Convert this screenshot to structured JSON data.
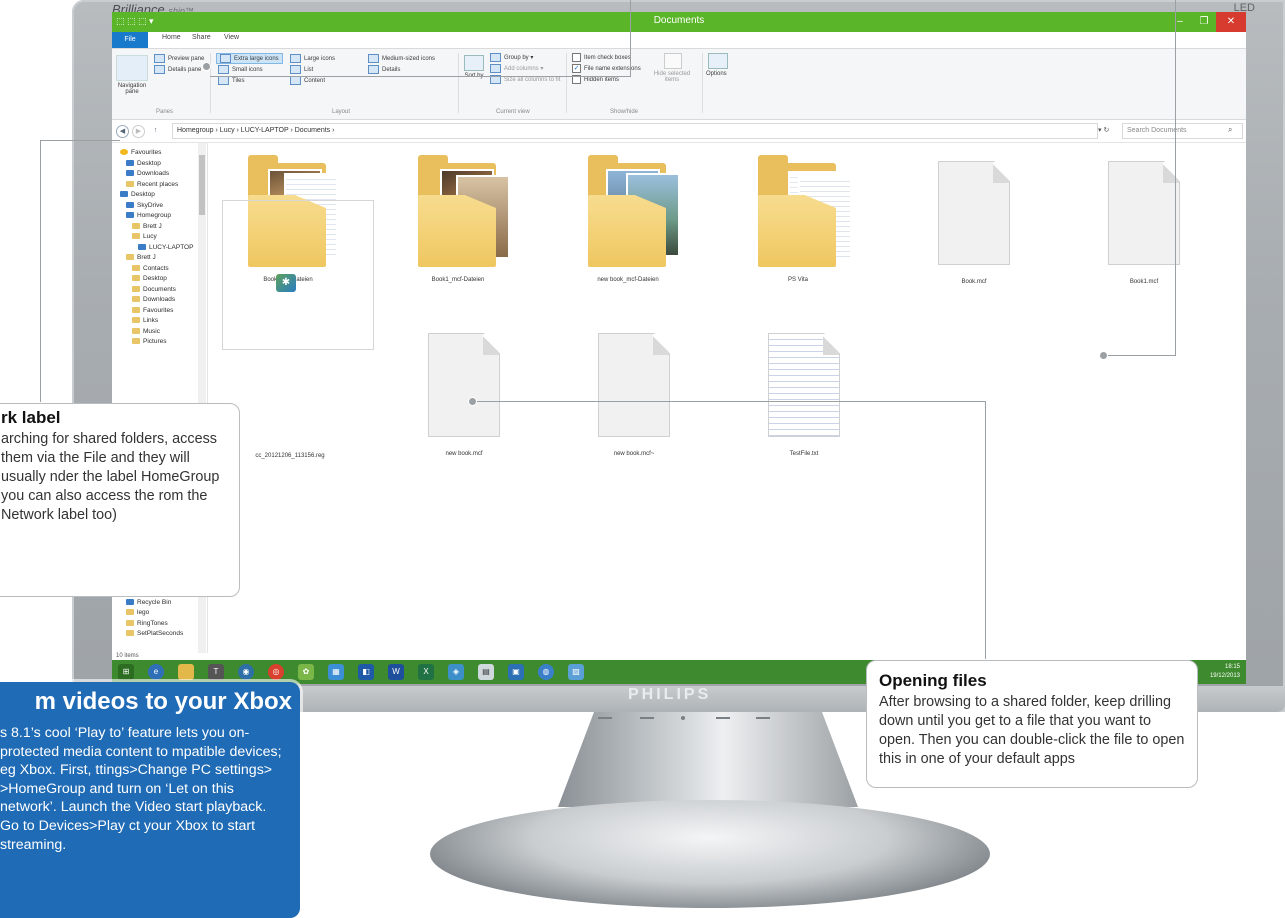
{
  "monitor": {
    "brand": "Brilliance",
    "brand_suffix": "ship™",
    "badge": "LED",
    "logo": "PHILIPS"
  },
  "window": {
    "title": "Documents",
    "qat": "⬚ ⬚ ⬚ ▾",
    "controls": {
      "minimize": "–",
      "maximize": "❐",
      "close": "✕"
    }
  },
  "ribbon": {
    "tabs": [
      "File",
      "Home",
      "Share",
      "View"
    ],
    "panes": {
      "nav_pane": "Navigation pane",
      "preview_pane": "Preview pane",
      "details_pane": "Details pane",
      "group": "Panes"
    },
    "layout": {
      "extra_large": "Extra large icons",
      "large": "Large icons",
      "medium": "Medium-sized icons",
      "small": "Small icons",
      "list": "List",
      "details": "Details",
      "tiles": "Tiles",
      "content": "Content",
      "group": "Layout"
    },
    "current_view": {
      "sort_by": "Sort by",
      "group_by": "Group by",
      "add_columns": "Add columns",
      "size_all": "Size all columns to fit",
      "group": "Current view"
    },
    "show_hide": {
      "item_check": "Item check boxes",
      "file_ext": "File name extensions",
      "hidden": "Hidden items",
      "hide_selected": "Hide selected items",
      "group": "Show/hide"
    },
    "options": "Options"
  },
  "address": {
    "path": "Homegroup  ›  Lucy  ›  LUCY-LAPTOP  ›  Documents  ›",
    "search_placeholder": "Search Documents"
  },
  "nav": [
    {
      "label": "Favourites",
      "icon": "star"
    },
    {
      "label": "Desktop",
      "icon": "blue"
    },
    {
      "label": "Downloads",
      "icon": "blue"
    },
    {
      "label": "Recent places",
      "icon": "folder"
    },
    {
      "label": "Desktop",
      "icon": "blue"
    },
    {
      "label": "SkyDrive",
      "icon": "blue"
    },
    {
      "label": "Homegroup",
      "icon": "blue"
    },
    {
      "label": "Brett J",
      "icon": "folder"
    },
    {
      "label": "Lucy",
      "icon": "folder"
    },
    {
      "label": "LUCY-LAPTOP",
      "icon": "blue"
    },
    {
      "label": "Brett J",
      "icon": "folder"
    },
    {
      "label": "Contacts",
      "icon": "folder"
    },
    {
      "label": "Desktop",
      "icon": "folder"
    },
    {
      "label": "Documents",
      "icon": "folder"
    },
    {
      "label": "Downloads",
      "icon": "folder"
    },
    {
      "label": "Favourites",
      "icon": "folder"
    },
    {
      "label": "Links",
      "icon": "folder"
    },
    {
      "label": "Music",
      "icon": "folder"
    },
    {
      "label": "Pictures",
      "icon": "folder"
    }
  ],
  "nav_bottom": [
    {
      "label": "Control Panel",
      "icon": "blue"
    },
    {
      "label": "Recycle Bin",
      "icon": "blue"
    },
    {
      "label": "lego",
      "icon": "folder"
    },
    {
      "label": "RingTones",
      "icon": "folder"
    },
    {
      "label": "SetPlatSeconds",
      "icon": "folder"
    }
  ],
  "items": [
    "Book_mcf-Dateien",
    "Book1_mcf-Dateien",
    "new book_mcf-Dateien",
    "PS Vita",
    "Book.mcf",
    "Book1.mcf",
    "cc_20121206_113156.reg",
    "new book.mcf",
    "new book.mcf~",
    "TestFile.txt"
  ],
  "status": "10 items",
  "taskbar": {
    "time": "18:15",
    "date": "19/12/2013"
  },
  "callouts": {
    "network": {
      "title": "rk label",
      "body": "arching for shared folders, access them via the File and they will usually nder the label HomeGroup you can also access the rom the Network label too)"
    },
    "opening": {
      "title": "Opening files",
      "body": "After browsing to a shared folder, keep drilling down until you get to a file that you want to open. Then you can double-click the file to open this in one of your default apps"
    },
    "stream": {
      "title": "m videos to your Xbox",
      "body": "s 8.1’s cool ‘Play to’ feature lets you on-protected media content to mpatible devices; eg Xbox. First, ttings>Change PC settings> >HomeGroup and turn on ‘Let on this network’. Launch the Video start playback. Go to Devices>Play ct your Xbox to start streaming."
    }
  }
}
